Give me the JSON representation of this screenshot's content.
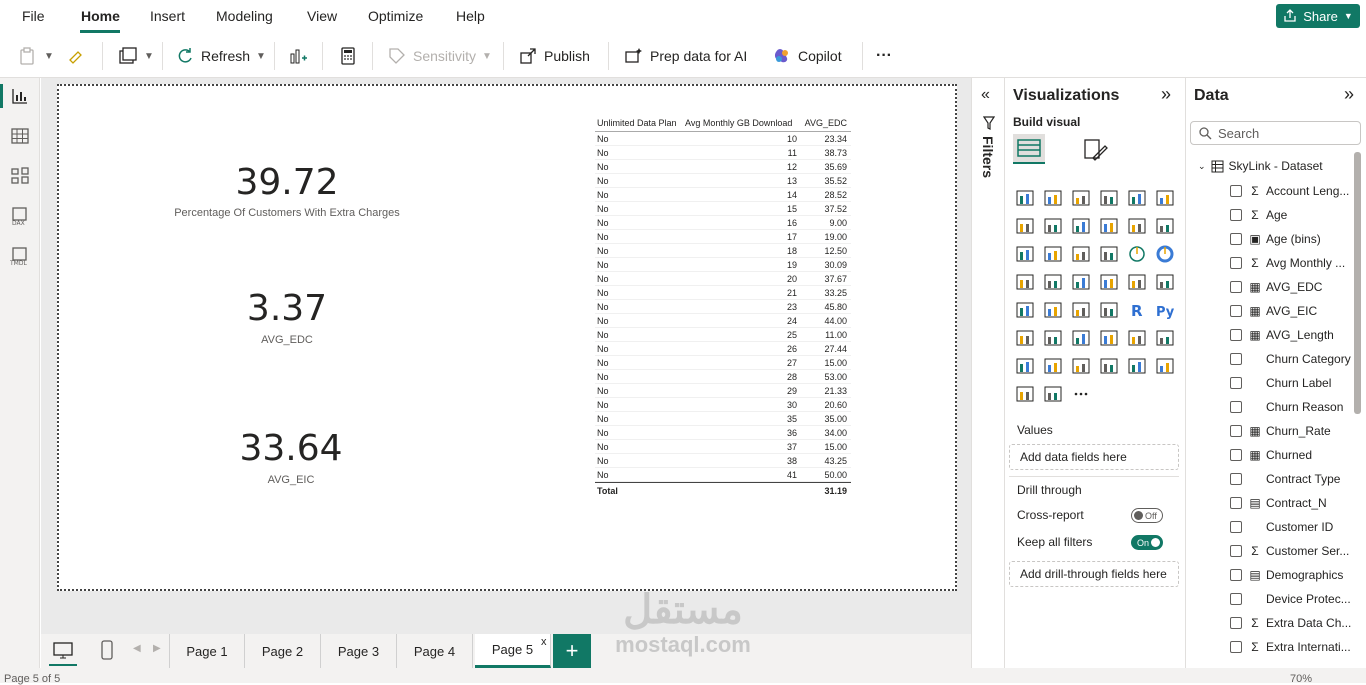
{
  "menu": {
    "items": [
      "File",
      "Home",
      "Insert",
      "Modeling",
      "View",
      "Optimize",
      "Help"
    ],
    "share_label": "Share"
  },
  "ribbon": {
    "refresh_label": "Refresh",
    "sensitivity_label": "Sensitivity",
    "publish_label": "Publish",
    "prep_label": "Prep data for AI",
    "copilot_label": "Copilot",
    "more_label": "···"
  },
  "cards": [
    {
      "value": "39.72",
      "label": "Percentage Of Customers With Extra Charges"
    },
    {
      "value": "3.37",
      "label": "AVG_EDC"
    },
    {
      "value": "33.64",
      "label": "AVG_EIC"
    }
  ],
  "table": {
    "headers": [
      "Unlimited Data Plan",
      "Avg Monthly GB Download",
      "AVG_EDC"
    ],
    "rows": [
      [
        "No",
        "10",
        "23.34"
      ],
      [
        "No",
        "11",
        "38.73"
      ],
      [
        "No",
        "12",
        "35.69"
      ],
      [
        "No",
        "13",
        "35.52"
      ],
      [
        "No",
        "14",
        "28.52"
      ],
      [
        "No",
        "15",
        "37.52"
      ],
      [
        "No",
        "16",
        "9.00"
      ],
      [
        "No",
        "17",
        "19.00"
      ],
      [
        "No",
        "18",
        "12.50"
      ],
      [
        "No",
        "19",
        "30.09"
      ],
      [
        "No",
        "20",
        "37.67"
      ],
      [
        "No",
        "21",
        "33.25"
      ],
      [
        "No",
        "23",
        "45.80"
      ],
      [
        "No",
        "24",
        "44.00"
      ],
      [
        "No",
        "25",
        "11.00"
      ],
      [
        "No",
        "26",
        "27.44"
      ],
      [
        "No",
        "27",
        "15.00"
      ],
      [
        "No",
        "28",
        "53.00"
      ],
      [
        "No",
        "29",
        "21.33"
      ],
      [
        "No",
        "30",
        "20.60"
      ],
      [
        "No",
        "35",
        "35.00"
      ],
      [
        "No",
        "36",
        "34.00"
      ],
      [
        "No",
        "37",
        "15.00"
      ],
      [
        "No",
        "38",
        "43.25"
      ],
      [
        "No",
        "41",
        "50.00"
      ]
    ],
    "total_label": "Total",
    "total_value": "31.19"
  },
  "pages": {
    "tabs": [
      "Page 1",
      "Page 2",
      "Page 3",
      "Page 4",
      "Page 5"
    ],
    "active": "Page 5",
    "close_label": "x",
    "add_label": "+"
  },
  "status": {
    "page_info": "Page 5 of 5",
    "zoom": "70%"
  },
  "filters": {
    "label": "Filters"
  },
  "visualizations": {
    "title": "Visualizations",
    "build_visual": "Build visual",
    "values_label": "Values",
    "values_placeholder": "Add data fields here",
    "drill_through": "Drill through",
    "cross_report": "Cross-report",
    "cross_report_state": "Off",
    "keep_filters": "Keep all filters",
    "keep_filters_state": "On",
    "drill_placeholder": "Add drill-through fields here"
  },
  "data_pane": {
    "title": "Data",
    "search_placeholder": "Search",
    "dataset": "SkyLink - Dataset",
    "fields": [
      {
        "name": "Account Leng...",
        "type": "Σ"
      },
      {
        "name": "Age",
        "type": "Σ"
      },
      {
        "name": "Age (bins)",
        "type": "▣"
      },
      {
        "name": "Avg Monthly ...",
        "type": "Σ"
      },
      {
        "name": "AVG_EDC",
        "type": "▦"
      },
      {
        "name": "AVG_EIC",
        "type": "▦"
      },
      {
        "name": "AVG_Length",
        "type": "▦"
      },
      {
        "name": "Churn Category",
        "type": ""
      },
      {
        "name": "Churn Label",
        "type": ""
      },
      {
        "name": "Churn Reason",
        "type": ""
      },
      {
        "name": "Churn_Rate",
        "type": "▦"
      },
      {
        "name": "Churned",
        "type": "▦"
      },
      {
        "name": "Contract Type",
        "type": ""
      },
      {
        "name": "Contract_N",
        "type": "▤"
      },
      {
        "name": "Customer ID",
        "type": ""
      },
      {
        "name": "Customer Ser...",
        "type": "Σ"
      },
      {
        "name": "Demographics",
        "type": "▤"
      },
      {
        "name": "Device Protec...",
        "type": ""
      },
      {
        "name": "Extra Data Ch...",
        "type": "Σ"
      },
      {
        "name": "Extra Internati...",
        "type": "Σ"
      }
    ]
  },
  "watermark": {
    "line1": "مستقل",
    "line2": "mostaql.com"
  }
}
